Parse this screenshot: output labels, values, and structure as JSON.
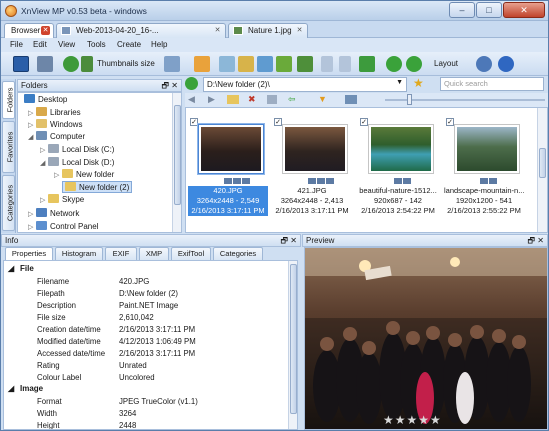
{
  "window": {
    "title": "XnView MP v0.53 beta - windows",
    "btn_min": "–",
    "btn_max": "□",
    "btn_close": "✕"
  },
  "tabs": [
    {
      "label": "Browser",
      "close": "✕"
    },
    {
      "label": "Web-2013-04-20_16-...",
      "close": "✕"
    },
    {
      "label": "Nature 1.jpg",
      "close": "✕"
    }
  ],
  "menu": [
    "File",
    "Edit",
    "View",
    "Tools",
    "Create",
    "Help"
  ],
  "toolbar": {
    "thumbnails_size": "Thumbnails size",
    "layout": "Layout",
    "search_placeholder": "Quick search"
  },
  "side_tabs": [
    "Folders",
    "Favorites",
    "Categories"
  ],
  "folders_panel": {
    "title": "Folders",
    "items": [
      {
        "label": "Desktop"
      },
      {
        "label": "Libraries"
      },
      {
        "label": "Windows"
      },
      {
        "label": "Computer"
      },
      {
        "label": "Local Disk (C:)"
      },
      {
        "label": "Local Disk (D:)"
      },
      {
        "label": "New folder"
      },
      {
        "label": "New folder (2)"
      },
      {
        "label": "Skype"
      },
      {
        "label": "Network"
      },
      {
        "label": "Control Panel"
      }
    ]
  },
  "path": "D:\\New folder (2)\\",
  "thumbnails": [
    {
      "name": "420.JPG",
      "dims": "3264x2448 - 2,549",
      "date": "2/16/2013 3:17:11 PM",
      "checked": "✓",
      "badges": [
        "a",
        "b",
        "EXIF"
      ]
    },
    {
      "name": "421.JPG",
      "dims": "3264x2448 - 2,413",
      "date": "2/16/2013 3:17:11 PM",
      "checked": "✓",
      "badges": [
        "a",
        "b",
        "EXIF"
      ]
    },
    {
      "name": "beautiful-nature-1512...",
      "dims": "920x687 - 142",
      "date": "2/16/2013 2:54:22 PM",
      "checked": "✓",
      "badges": [
        "a",
        "b"
      ]
    },
    {
      "name": "landscape-mountain-n...",
      "dims": "1920x1200 - 541",
      "date": "2/16/2013 2:55:22 PM",
      "checked": "✓",
      "badges": [
        "a",
        "b"
      ]
    }
  ],
  "info_panel": {
    "title": "Info",
    "tabs": [
      "Properties",
      "Histogram",
      "EXIF",
      "XMP",
      "ExifTool",
      "Categories"
    ],
    "groups": [
      {
        "name": "File",
        "rows": [
          {
            "k": "Filename",
            "v": "420.JPG"
          },
          {
            "k": "Filepath",
            "v": "D:\\New folder (2)"
          },
          {
            "k": "Description",
            "v": "Paint.NET Image"
          },
          {
            "k": "File size",
            "v": "2,610,042"
          },
          {
            "k": "Creation date/time",
            "v": "2/16/2013 3:17:11 PM"
          },
          {
            "k": "Modified date/time",
            "v": "4/12/2013 1:06:49 PM"
          },
          {
            "k": "Accessed date/time",
            "v": "2/16/2013 3:17:11 PM"
          },
          {
            "k": "Rating",
            "v": "Unrated"
          },
          {
            "k": "Colour Label",
            "v": "Uncolored"
          }
        ]
      },
      {
        "name": "Image",
        "rows": [
          {
            "k": "Format",
            "v": "JPEG TrueColor (v1.1)"
          },
          {
            "k": "Width",
            "v": "3264"
          },
          {
            "k": "Height",
            "v": "2448"
          }
        ]
      }
    ]
  },
  "preview_panel": {
    "title": "Preview",
    "rating_stars": "★★★★★"
  },
  "panel_controls": {
    "pin": "🗗",
    "close": "✕"
  },
  "colors": {
    "accent": "#3d89e0",
    "frame": "#cfdff2",
    "close_red": "#d0442d"
  }
}
